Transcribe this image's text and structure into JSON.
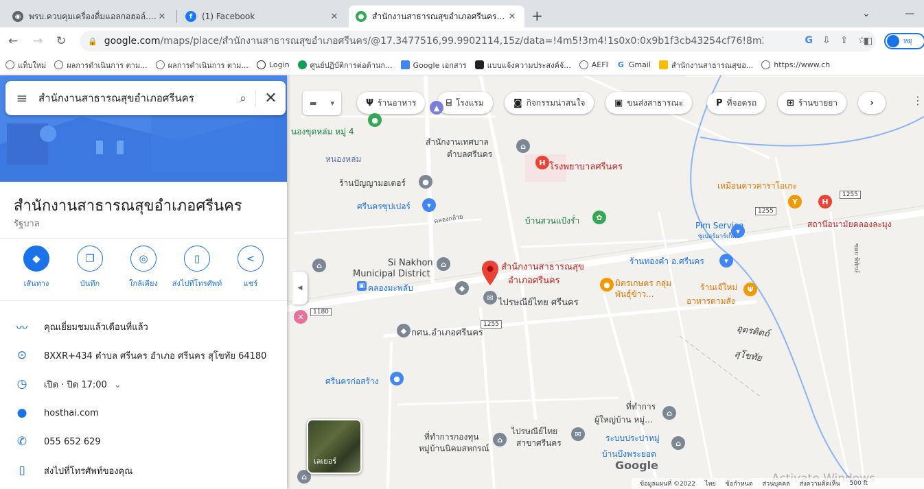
{
  "tabs": [
    {
      "title": "พรบ.ควบคุมเครื่องดื่มแอลกอฮอล์.pdf",
      "close": "✕",
      "icon": "globe-icon"
    },
    {
      "title": "(1) Facebook",
      "close": "✕",
      "icon": "facebook-icon"
    },
    {
      "title": "สำนักงานสาธารณสุขอำเภอศรีนคร - G",
      "close": "✕",
      "icon": "maps-pin-icon"
    }
  ],
  "new_tab": "+",
  "address": {
    "url_host": "google.com",
    "url_path": "/maps/place/สำนักงานสาธารณสุขอำเภอศรีนคร/@17.3477516,99.9902114,15z/data=!4m5!3m4!1s0x0:0x9b1f3cb43254cf76!8m2!3d17.3477..."
  },
  "profile_label": "หยุ",
  "bookmarks": [
    "แท็บใหม่",
    "ผลการดำเนินการ ตาม...",
    "ผลการดำเนินการ ตาม...",
    "Login",
    "ศูนย์ปฏิบัติการต่อต้านก...",
    "Google เอกสาร",
    "แบบแจ้งความประสงค์จั...",
    "AEFI",
    "Gmail",
    "สำนักงานสาธารณสุขอ...",
    "https://www.ch"
  ],
  "search": {
    "query": "สำนักงานสาธารณสุขอำเภอศรีนคร"
  },
  "place": {
    "title": "สำนักงานสาธารณสุขอำเภอศรีนคร",
    "category": "รัฐบาล"
  },
  "actions": [
    {
      "label": "เส้นทาง",
      "icon": "directions-icon"
    },
    {
      "label": "บันทึก",
      "icon": "bookmark-icon"
    },
    {
      "label": "ใกล้เคียง",
      "icon": "nearby-icon"
    },
    {
      "label": "ส่งไปที่โทรศัพท์",
      "icon": "send-to-phone-icon"
    },
    {
      "label": "แชร์",
      "icon": "share-icon"
    }
  ],
  "info": {
    "visited": "คุณเยี่ยมชมแล้วเดือนที่แล้ว",
    "address": "8XXR+434 ตำบล ศรีนคร อำเภอ ศรีนคร สุโขทัย 64180",
    "hours": "เปิด · ปิด 17:00",
    "website": "hosthai.com",
    "phone": "055 652 629",
    "send_phone": "ส่งไปที่โทรศัพท์ของคุณ"
  },
  "chips": [
    {
      "label": "ร้านอาหาร",
      "icon": "restaurant-icon"
    },
    {
      "label": "โรงแรม",
      "icon": "hotel-icon"
    },
    {
      "label": "กิจกรรมน่าสนใจ",
      "icon": "attraction-icon"
    },
    {
      "label": "ขนส่งสาธารณะ",
      "icon": "transit-icon"
    },
    {
      "label": "ที่จอดรถ",
      "icon": "parking-icon"
    },
    {
      "label": "ร้านขายยา",
      "icon": "pharmacy-icon"
    }
  ],
  "map_labels": {
    "l1": "สำนักงานเทศบาล",
    "l2": "ตำบลศรีนคร",
    "l3": "โรงพยาบาลศรีนคร",
    "l4": "หนองหล่ม",
    "l5": "ร้านปัญญามอเตอร์",
    "l6": "ศรีนครซุปเปอร์",
    "l7": "บ้านสวนแป้งร่ำ",
    "l8": "เหมือนดาวคาราโอเกะ",
    "l9": "สถานีอนามัยคลองละมุง",
    "l10": "Pim Service",
    "l11": "ซูเปอร์มาร์เก็ต",
    "l12": "Si Nakhon",
    "l13": "Municipal District",
    "l14": "คลองมะพลับ",
    "l15": "สำนักงานสาธารณสุข",
    "l16": "อำเภอศรีนคร",
    "l17": "ร้านทองคำ อ.ศรีนคร",
    "l18": "มิตรเกษตร กลุ่ม",
    "l19": "พันธุ์ข้าว...",
    "l20": "ร้านเจ๊ใหม่",
    "l21": "อาหารตามสั่ง",
    "l22": "ไปรษณีย์ไทย ศรีนคร",
    "l23": "กศน.อำเภอศรีนคร",
    "l24": "อุตรดิตถ์",
    "l25": "สุโขทัย",
    "l26": "ศรีนครก่อสร้าง",
    "l27": "ที่ทำการ",
    "l28": "ผู้ใหญ่บ้าน หมู่...",
    "l29": "ระบบประปาหมู่",
    "l30": "บ้านบึงพระยอด",
    "l31": "ไปรษณีย์ไทย",
    "l32": "สาขาศรีนคร",
    "l33": "ที่ทำการกองทุน",
    "l34": "หมู่บ้านนิคมสหกรณ์",
    "l35": "นองขุดหล่ม หมู่ 4",
    "l36": "คลองกล้วย",
    "l37": "ซอย พิทักษ์"
  },
  "shields": [
    "1255",
    "1255",
    "1180",
    "1255"
  ],
  "layer_label": "เลเยอร์",
  "google_logo": "Google",
  "footer": [
    "ข้อมูลแผนที่ ©2022",
    "ไทย",
    "ข้อกำหนด",
    "ส่วนบุคคล",
    "ส่งความคิดเห็น",
    "500 ft"
  ],
  "watermark": "Activate Windows",
  "colors": {
    "accent": "#1a73e8",
    "hospital": "#ea4335",
    "food": "#f29900",
    "park": "#34a853",
    "service": "#4285f4",
    "place_title": "#c5221f"
  }
}
